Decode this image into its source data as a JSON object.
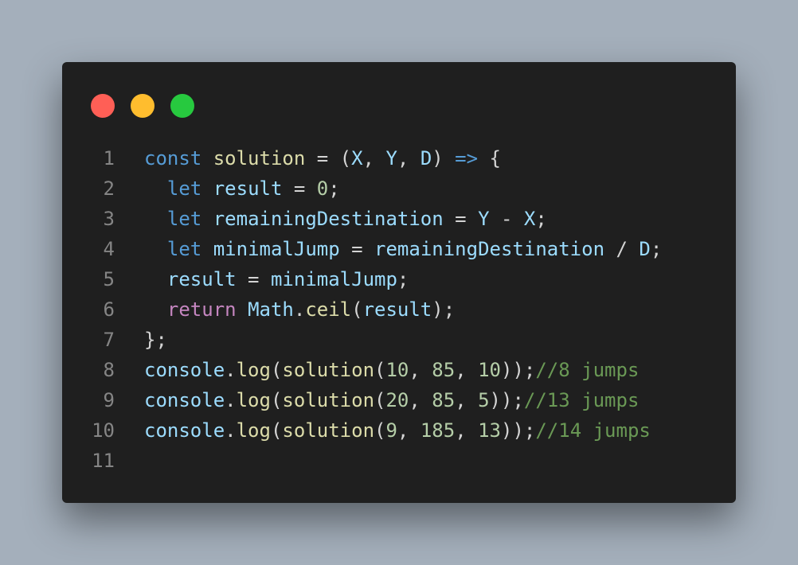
{
  "window": {
    "dots": [
      {
        "name": "red",
        "color": "#ff5f56"
      },
      {
        "name": "yellow",
        "color": "#ffbd2e"
      },
      {
        "name": "green",
        "color": "#27c93f"
      }
    ]
  },
  "colors": {
    "keyword": "#569cd6",
    "control_keyword": "#c586c0",
    "function": "#dcdcaa",
    "variable": "#9cdcfe",
    "number": "#b5cea8",
    "comment": "#6a9955",
    "punctuation": "#d4d4d4",
    "line_number": "#858585",
    "background": "#1f1f1f",
    "page_background": "#a4afbb"
  },
  "code": {
    "lines": [
      {
        "num": "1",
        "tokens": [
          {
            "t": "const",
            "c": "kw"
          },
          {
            "t": " ",
            "c": "pn"
          },
          {
            "t": "solution",
            "c": "fn"
          },
          {
            "t": " = (",
            "c": "pn"
          },
          {
            "t": "X",
            "c": "var"
          },
          {
            "t": ", ",
            "c": "pn"
          },
          {
            "t": "Y",
            "c": "var"
          },
          {
            "t": ", ",
            "c": "pn"
          },
          {
            "t": "D",
            "c": "var"
          },
          {
            "t": ") ",
            "c": "pn"
          },
          {
            "t": "=>",
            "c": "kw"
          },
          {
            "t": " {",
            "c": "pn"
          }
        ]
      },
      {
        "num": "2",
        "tokens": [
          {
            "t": "  ",
            "c": "pn"
          },
          {
            "t": "let",
            "c": "kw"
          },
          {
            "t": " ",
            "c": "pn"
          },
          {
            "t": "result",
            "c": "var"
          },
          {
            "t": " = ",
            "c": "pn"
          },
          {
            "t": "0",
            "c": "num"
          },
          {
            "t": ";",
            "c": "pn"
          }
        ]
      },
      {
        "num": "3",
        "tokens": [
          {
            "t": "  ",
            "c": "pn"
          },
          {
            "t": "let",
            "c": "kw"
          },
          {
            "t": " ",
            "c": "pn"
          },
          {
            "t": "remainingDestination",
            "c": "var"
          },
          {
            "t": " = ",
            "c": "pn"
          },
          {
            "t": "Y",
            "c": "var"
          },
          {
            "t": " - ",
            "c": "pn"
          },
          {
            "t": "X",
            "c": "var"
          },
          {
            "t": ";",
            "c": "pn"
          }
        ]
      },
      {
        "num": "4",
        "tokens": [
          {
            "t": "  ",
            "c": "pn"
          },
          {
            "t": "let",
            "c": "kw"
          },
          {
            "t": " ",
            "c": "pn"
          },
          {
            "t": "minimalJump",
            "c": "var"
          },
          {
            "t": " = ",
            "c": "pn"
          },
          {
            "t": "remainingDestination",
            "c": "var"
          },
          {
            "t": " / ",
            "c": "pn"
          },
          {
            "t": "D",
            "c": "var"
          },
          {
            "t": ";",
            "c": "pn"
          }
        ]
      },
      {
        "num": "5",
        "tokens": [
          {
            "t": "  ",
            "c": "pn"
          },
          {
            "t": "result",
            "c": "var"
          },
          {
            "t": " = ",
            "c": "pn"
          },
          {
            "t": "minimalJump",
            "c": "var"
          },
          {
            "t": ";",
            "c": "pn"
          }
        ]
      },
      {
        "num": "6",
        "tokens": [
          {
            "t": "  ",
            "c": "pn"
          },
          {
            "t": "return",
            "c": "kw2"
          },
          {
            "t": " ",
            "c": "pn"
          },
          {
            "t": "Math",
            "c": "var"
          },
          {
            "t": ".",
            "c": "pn"
          },
          {
            "t": "ceil",
            "c": "fn"
          },
          {
            "t": "(",
            "c": "pn"
          },
          {
            "t": "result",
            "c": "var"
          },
          {
            "t": ");",
            "c": "pn"
          }
        ]
      },
      {
        "num": "7",
        "tokens": [
          {
            "t": "};",
            "c": "pn"
          }
        ]
      },
      {
        "num": "8",
        "tokens": [
          {
            "t": "console",
            "c": "var"
          },
          {
            "t": ".",
            "c": "pn"
          },
          {
            "t": "log",
            "c": "fn"
          },
          {
            "t": "(",
            "c": "pn"
          },
          {
            "t": "solution",
            "c": "fn"
          },
          {
            "t": "(",
            "c": "pn"
          },
          {
            "t": "10",
            "c": "num"
          },
          {
            "t": ", ",
            "c": "pn"
          },
          {
            "t": "85",
            "c": "num"
          },
          {
            "t": ", ",
            "c": "pn"
          },
          {
            "t": "10",
            "c": "num"
          },
          {
            "t": "));",
            "c": "pn"
          },
          {
            "t": "//8 jumps",
            "c": "cm"
          }
        ]
      },
      {
        "num": "9",
        "tokens": [
          {
            "t": "console",
            "c": "var"
          },
          {
            "t": ".",
            "c": "pn"
          },
          {
            "t": "log",
            "c": "fn"
          },
          {
            "t": "(",
            "c": "pn"
          },
          {
            "t": "solution",
            "c": "fn"
          },
          {
            "t": "(",
            "c": "pn"
          },
          {
            "t": "20",
            "c": "num"
          },
          {
            "t": ", ",
            "c": "pn"
          },
          {
            "t": "85",
            "c": "num"
          },
          {
            "t": ", ",
            "c": "pn"
          },
          {
            "t": "5",
            "c": "num"
          },
          {
            "t": "));",
            "c": "pn"
          },
          {
            "t": "//13 jumps",
            "c": "cm"
          }
        ]
      },
      {
        "num": "10",
        "tokens": [
          {
            "t": "console",
            "c": "var"
          },
          {
            "t": ".",
            "c": "pn"
          },
          {
            "t": "log",
            "c": "fn"
          },
          {
            "t": "(",
            "c": "pn"
          },
          {
            "t": "solution",
            "c": "fn"
          },
          {
            "t": "(",
            "c": "pn"
          },
          {
            "t": "9",
            "c": "num"
          },
          {
            "t": ", ",
            "c": "pn"
          },
          {
            "t": "185",
            "c": "num"
          },
          {
            "t": ", ",
            "c": "pn"
          },
          {
            "t": "13",
            "c": "num"
          },
          {
            "t": "));",
            "c": "pn"
          },
          {
            "t": "//14 jumps",
            "c": "cm"
          }
        ]
      },
      {
        "num": "11",
        "tokens": []
      }
    ]
  }
}
